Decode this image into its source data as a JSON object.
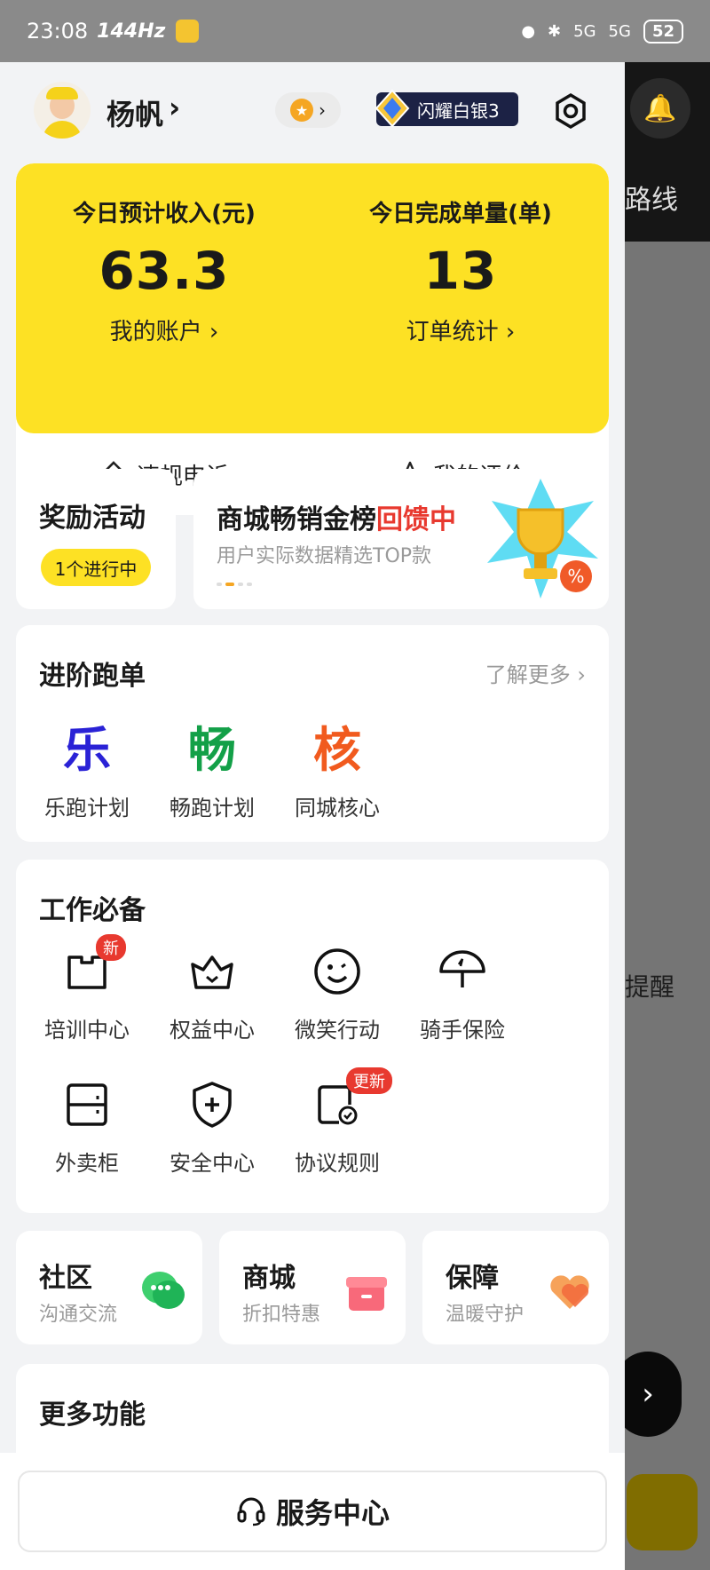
{
  "status_bar": {
    "time": "23:08",
    "refresh": "144Hz",
    "net1": "5G",
    "net2": "5G",
    "battery": "52"
  },
  "background": {
    "route_text": "路线",
    "remind_text": "提醒",
    "next_glyph": "›",
    "bell_icon": "bell-icon"
  },
  "profile": {
    "name": "杨帆",
    "name_arrow": "›",
    "star_arrow": "›",
    "rank_label": "闪耀白银3"
  },
  "earnings": {
    "income_label": "今日预计收入(元)",
    "income_value": "63.3",
    "account_link": "我的账户 ›",
    "orders_label": "今日完成单量(单)",
    "orders_value": "13",
    "stats_link": "订单统计 ›",
    "appeal_label": "违规申诉",
    "review_label": "我的评价"
  },
  "reward": {
    "title": "奖励活动",
    "badge": "1个进行中"
  },
  "banner": {
    "title_main": "商城畅销金榜",
    "title_red": "回馈中",
    "subtitle": "用户实际数据精选TOP款"
  },
  "advanced": {
    "title": "进阶跑单",
    "more": "了解更多 ›",
    "items": [
      {
        "glyph": "乐",
        "label": "乐跑计划",
        "color": "#2a22d6"
      },
      {
        "glyph": "畅",
        "label": "畅跑计划",
        "color": "#13a048"
      },
      {
        "glyph": "核",
        "label": "同城核心",
        "color": "#f15a1e"
      }
    ]
  },
  "work": {
    "title": "工作必备",
    "items": [
      {
        "label": "培训中心",
        "icon": "training-book-icon",
        "badge": "新"
      },
      {
        "label": "权益中心",
        "icon": "crown-icon"
      },
      {
        "label": "微笑行动",
        "icon": "smile-icon"
      },
      {
        "label": "骑手保险",
        "icon": "umbrella-icon"
      },
      {
        "label": "外卖柜",
        "icon": "locker-icon"
      },
      {
        "label": "安全中心",
        "icon": "shield-plus-icon"
      },
      {
        "label": "协议规则",
        "icon": "agreement-icon",
        "badge": "更新"
      }
    ]
  },
  "tri_cards": [
    {
      "title": "社区",
      "subtitle": "沟通交流",
      "icon": "chat-bubble-icon"
    },
    {
      "title": "商城",
      "subtitle": "折扣特惠",
      "icon": "gift-box-icon"
    },
    {
      "title": "保障",
      "subtitle": "温暖守护",
      "icon": "heart-icon"
    }
  ],
  "more_functions": {
    "title": "更多功能"
  },
  "service": {
    "label": "服务中心"
  },
  "colors": {
    "brand_yellow": "#fde124",
    "accent_red": "#e8392f"
  }
}
